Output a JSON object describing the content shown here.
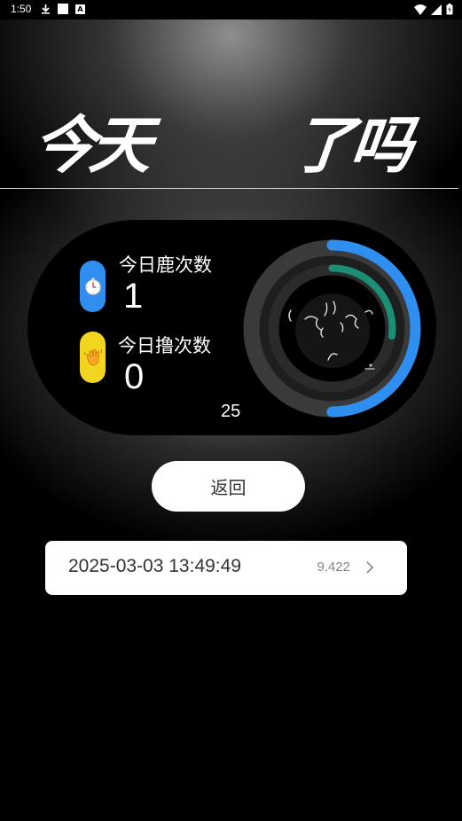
{
  "status_bar": {
    "time": "1:50",
    "icons": [
      "download-icon",
      "square-notification-icon",
      "a-notification-icon",
      "wifi-icon",
      "signal-icon",
      "battery-icon"
    ]
  },
  "header": {
    "title_left": "今天",
    "title_right": "了吗"
  },
  "stats": {
    "lu_label": "今日鹿次数",
    "lu_value": "1",
    "lu_icon": "stopwatch-icon",
    "lu_icon_color": "#2f8ef0",
    "lu2_label": "今日撸次数",
    "lu2_value": "0",
    "lu2_icon": "waving-hand-icon",
    "lu2_icon_color": "#f2d51e",
    "counter": "25"
  },
  "gauge": {
    "outer_progress": 0.5,
    "outer_color": "#2e8ff0",
    "inner_progress": 0.27,
    "inner_color": "#1a8f74"
  },
  "actions": {
    "back_label": "返回"
  },
  "records": [
    {
      "time": "2025-03-03 13:49:49",
      "value": "9.422"
    }
  ]
}
